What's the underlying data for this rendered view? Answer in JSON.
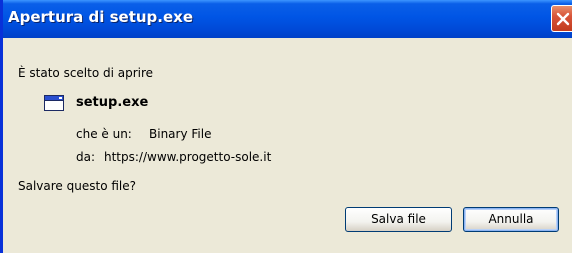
{
  "dialog": {
    "title": "Apertura di setup.exe",
    "intro": "È stato scelto di aprire",
    "file_name": "setup.exe",
    "type_label": "che è un:",
    "type_value": "Binary File",
    "source_label": "da:",
    "source_value": "https://www.progetto-sole.it",
    "question": "Salvare questo file?",
    "buttons": {
      "save": "Salva file",
      "cancel": "Annulla"
    }
  },
  "colors": {
    "titlebar": "#0055e5",
    "dialog_bg": "#ece9d8",
    "close_button": "#d8553a",
    "button_border": "#003c74"
  },
  "icons": {
    "file": "exe-file-icon",
    "close": "close-icon"
  }
}
